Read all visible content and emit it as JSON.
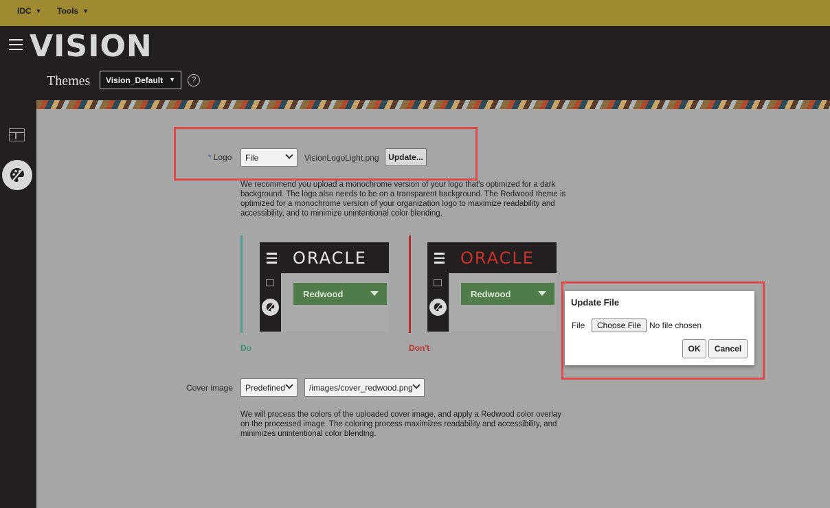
{
  "topbar": {
    "menus": [
      {
        "label": "IDC"
      },
      {
        "label": "Tools"
      }
    ],
    "color": "#a08a31"
  },
  "header": {
    "brand": "VISION",
    "page_title": "Themes",
    "theme_select": {
      "value": "Vision_Default"
    },
    "help": "?"
  },
  "logo_field": {
    "label": "Logo",
    "required_mark": "*",
    "source_select": "File",
    "file_name": "VisionLogoLight.png",
    "update_button": "Update...",
    "description": "We recommend you upload a monochrome version of your logo that's optimized for a dark background. The logo also needs to be on a transparent background. The Redwood theme is optimized for a monochrome version of your organization logo to maximize readability and accessibility, and to minimize unintentional color blending."
  },
  "previews": [
    {
      "logo_text": "ORACLE",
      "pill_label": "Redwood",
      "caption": "Do",
      "caption_color": "#3e8e7e",
      "logo_color": "#e8e8e8",
      "accent": "#4f9a8e"
    },
    {
      "logo_text": "ORACLE",
      "pill_label": "Redwood",
      "caption": "Don't",
      "caption_color": "#b5332e",
      "logo_color": "#c8322a",
      "accent": "#b5332e"
    }
  ],
  "cover_image": {
    "label": "Cover image",
    "source_select": "Predefined",
    "path_select": "/images/cover_redwood.png",
    "description": "We will process the colors of the uploaded cover image, and apply a Redwood color overlay on the processed image. The coloring process maximizes readability and accessibility, and minimizes unintentional color blending."
  },
  "dialog": {
    "title": "Update File",
    "file_label": "File",
    "choose_button": "Choose File",
    "no_file_text": "No file chosen",
    "ok_button": "OK",
    "cancel_button": "Cancel"
  },
  "highlight_color": "#e0474a"
}
